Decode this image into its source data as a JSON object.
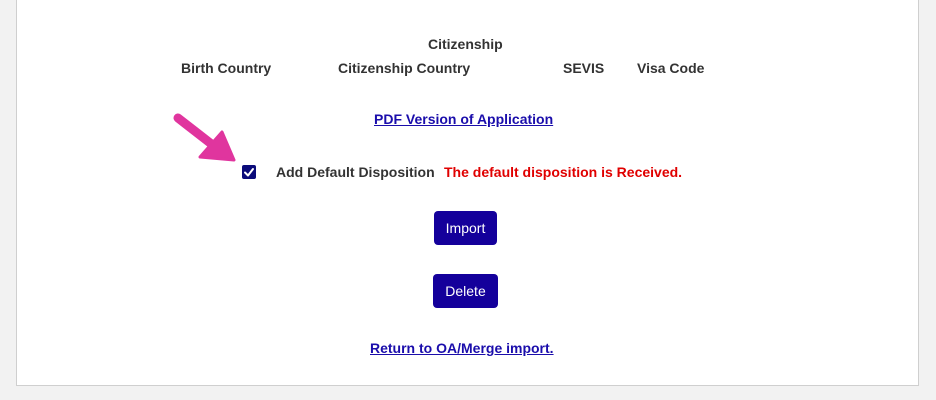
{
  "table_header": {
    "citizenship_group": "Citizenship",
    "columns": [
      "Birth Country",
      "Citizenship Country",
      "SEVIS",
      "Visa Code"
    ]
  },
  "pdf_link": "PDF Version of Application",
  "disposition": {
    "checkbox_checked": true,
    "label": "Add Default Disposition",
    "message": "The default disposition is Received."
  },
  "buttons": {
    "import": "Import",
    "delete": "Delete"
  },
  "return_link": "Return to OA/Merge import.",
  "colors": {
    "button": "#14009b",
    "link": "#1a0dab",
    "error": "#e00000",
    "arrow": "#e0359e"
  }
}
